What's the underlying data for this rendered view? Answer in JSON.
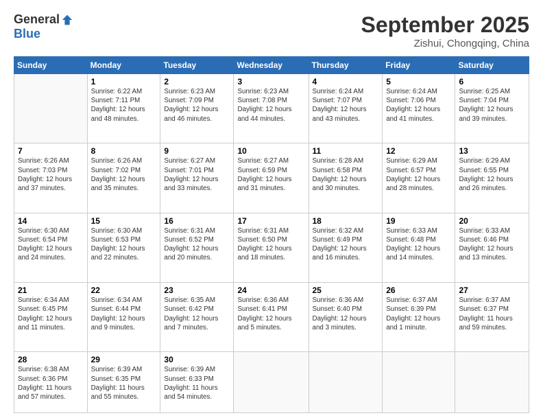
{
  "header": {
    "logo_general": "General",
    "logo_blue": "Blue",
    "month_title": "September 2025",
    "subtitle": "Zishui, Chongqing, China"
  },
  "days_of_week": [
    "Sunday",
    "Monday",
    "Tuesday",
    "Wednesday",
    "Thursday",
    "Friday",
    "Saturday"
  ],
  "weeks": [
    [
      {
        "day": "",
        "info": ""
      },
      {
        "day": "1",
        "info": "Sunrise: 6:22 AM\nSunset: 7:11 PM\nDaylight: 12 hours\nand 48 minutes."
      },
      {
        "day": "2",
        "info": "Sunrise: 6:23 AM\nSunset: 7:09 PM\nDaylight: 12 hours\nand 46 minutes."
      },
      {
        "day": "3",
        "info": "Sunrise: 6:23 AM\nSunset: 7:08 PM\nDaylight: 12 hours\nand 44 minutes."
      },
      {
        "day": "4",
        "info": "Sunrise: 6:24 AM\nSunset: 7:07 PM\nDaylight: 12 hours\nand 43 minutes."
      },
      {
        "day": "5",
        "info": "Sunrise: 6:24 AM\nSunset: 7:06 PM\nDaylight: 12 hours\nand 41 minutes."
      },
      {
        "day": "6",
        "info": "Sunrise: 6:25 AM\nSunset: 7:04 PM\nDaylight: 12 hours\nand 39 minutes."
      }
    ],
    [
      {
        "day": "7",
        "info": "Sunrise: 6:26 AM\nSunset: 7:03 PM\nDaylight: 12 hours\nand 37 minutes."
      },
      {
        "day": "8",
        "info": "Sunrise: 6:26 AM\nSunset: 7:02 PM\nDaylight: 12 hours\nand 35 minutes."
      },
      {
        "day": "9",
        "info": "Sunrise: 6:27 AM\nSunset: 7:01 PM\nDaylight: 12 hours\nand 33 minutes."
      },
      {
        "day": "10",
        "info": "Sunrise: 6:27 AM\nSunset: 6:59 PM\nDaylight: 12 hours\nand 31 minutes."
      },
      {
        "day": "11",
        "info": "Sunrise: 6:28 AM\nSunset: 6:58 PM\nDaylight: 12 hours\nand 30 minutes."
      },
      {
        "day": "12",
        "info": "Sunrise: 6:29 AM\nSunset: 6:57 PM\nDaylight: 12 hours\nand 28 minutes."
      },
      {
        "day": "13",
        "info": "Sunrise: 6:29 AM\nSunset: 6:55 PM\nDaylight: 12 hours\nand 26 minutes."
      }
    ],
    [
      {
        "day": "14",
        "info": "Sunrise: 6:30 AM\nSunset: 6:54 PM\nDaylight: 12 hours\nand 24 minutes."
      },
      {
        "day": "15",
        "info": "Sunrise: 6:30 AM\nSunset: 6:53 PM\nDaylight: 12 hours\nand 22 minutes."
      },
      {
        "day": "16",
        "info": "Sunrise: 6:31 AM\nSunset: 6:52 PM\nDaylight: 12 hours\nand 20 minutes."
      },
      {
        "day": "17",
        "info": "Sunrise: 6:31 AM\nSunset: 6:50 PM\nDaylight: 12 hours\nand 18 minutes."
      },
      {
        "day": "18",
        "info": "Sunrise: 6:32 AM\nSunset: 6:49 PM\nDaylight: 12 hours\nand 16 minutes."
      },
      {
        "day": "19",
        "info": "Sunrise: 6:33 AM\nSunset: 6:48 PM\nDaylight: 12 hours\nand 14 minutes."
      },
      {
        "day": "20",
        "info": "Sunrise: 6:33 AM\nSunset: 6:46 PM\nDaylight: 12 hours\nand 13 minutes."
      }
    ],
    [
      {
        "day": "21",
        "info": "Sunrise: 6:34 AM\nSunset: 6:45 PM\nDaylight: 12 hours\nand 11 minutes."
      },
      {
        "day": "22",
        "info": "Sunrise: 6:34 AM\nSunset: 6:44 PM\nDaylight: 12 hours\nand 9 minutes."
      },
      {
        "day": "23",
        "info": "Sunrise: 6:35 AM\nSunset: 6:42 PM\nDaylight: 12 hours\nand 7 minutes."
      },
      {
        "day": "24",
        "info": "Sunrise: 6:36 AM\nSunset: 6:41 PM\nDaylight: 12 hours\nand 5 minutes."
      },
      {
        "day": "25",
        "info": "Sunrise: 6:36 AM\nSunset: 6:40 PM\nDaylight: 12 hours\nand 3 minutes."
      },
      {
        "day": "26",
        "info": "Sunrise: 6:37 AM\nSunset: 6:39 PM\nDaylight: 12 hours\nand 1 minute."
      },
      {
        "day": "27",
        "info": "Sunrise: 6:37 AM\nSunset: 6:37 PM\nDaylight: 11 hours\nand 59 minutes."
      }
    ],
    [
      {
        "day": "28",
        "info": "Sunrise: 6:38 AM\nSunset: 6:36 PM\nDaylight: 11 hours\nand 57 minutes."
      },
      {
        "day": "29",
        "info": "Sunrise: 6:39 AM\nSunset: 6:35 PM\nDaylight: 11 hours\nand 55 minutes."
      },
      {
        "day": "30",
        "info": "Sunrise: 6:39 AM\nSunset: 6:33 PM\nDaylight: 11 hours\nand 54 minutes."
      },
      {
        "day": "",
        "info": ""
      },
      {
        "day": "",
        "info": ""
      },
      {
        "day": "",
        "info": ""
      },
      {
        "day": "",
        "info": ""
      }
    ]
  ]
}
